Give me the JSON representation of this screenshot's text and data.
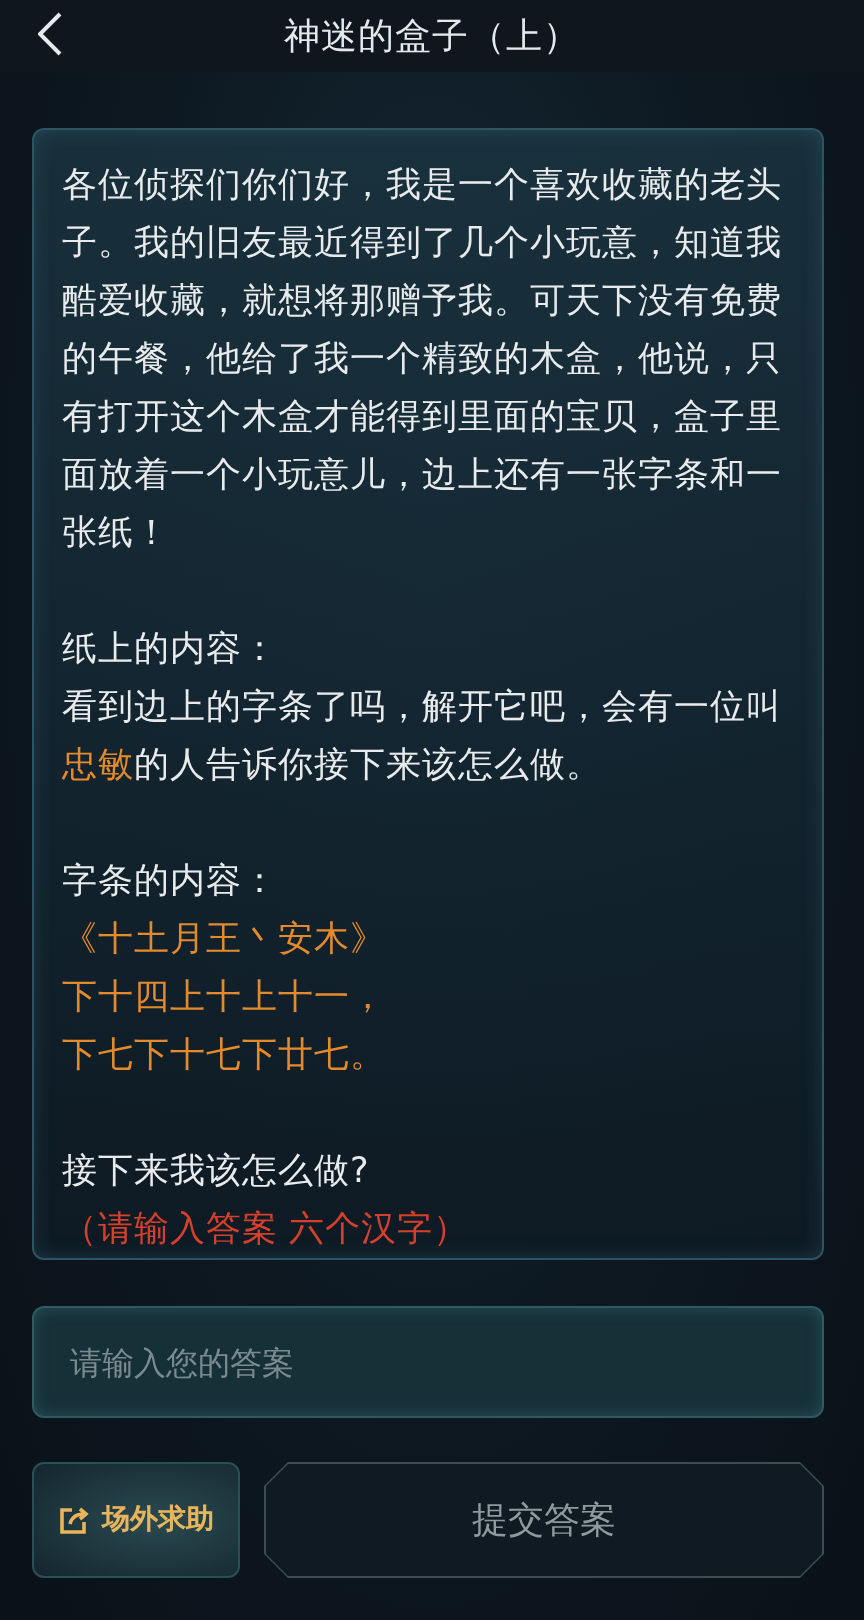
{
  "header": {
    "title": "神迷的盒子（上）"
  },
  "story": {
    "sections": [
      {
        "lines": [
          {
            "segments": [
              {
                "text": "各位侦探们你们好，我是一个喜欢收藏的老头子。我的旧友最近得到了几个小玩意，知道我酷爱收藏，就想将那赠予我。可天下没有免费的午餐，他给了我一个精致的木盒，他说，只有打开这个木盒才能得到里面的宝贝，盒子里面放着一个小玩意儿，边上还有一张字条和一张纸！",
                "color": "#e8eaec"
              }
            ]
          }
        ]
      },
      {
        "lines": [
          {
            "segments": [
              {
                "text": "纸上的内容：",
                "color": "#e8eaec"
              }
            ]
          },
          {
            "segments": [
              {
                "text": "看到边上的字条了吗，解开它吧，会有一位叫",
                "color": "#e8eaec"
              },
              {
                "text": "忠敏",
                "color": "#e38a2c"
              },
              {
                "text": "的人告诉你接下来该怎么做。",
                "color": "#e8eaec"
              }
            ]
          }
        ]
      },
      {
        "lines": [
          {
            "segments": [
              {
                "text": "字条的内容：",
                "color": "#e8eaec"
              }
            ]
          },
          {
            "segments": [
              {
                "text": "《十土月王丶安木》",
                "color": "#e38a2c"
              }
            ]
          },
          {
            "segments": [
              {
                "text": "下十四上十上十一，",
                "color": "#e38a2c"
              }
            ]
          },
          {
            "segments": [
              {
                "text": "下七下十七下廿七。",
                "color": "#e38a2c"
              }
            ]
          }
        ]
      },
      {
        "lines": [
          {
            "segments": [
              {
                "text": "接下来我该怎么做?",
                "color": "#e8eaec"
              }
            ]
          },
          {
            "segments": [
              {
                "text": "（请输入答案 六个汉字）",
                "color": "#d4402c"
              }
            ]
          }
        ]
      }
    ]
  },
  "answer": {
    "placeholder": "请输入您的答案"
  },
  "buttons": {
    "help": "场外求助",
    "submit": "提交答案"
  }
}
